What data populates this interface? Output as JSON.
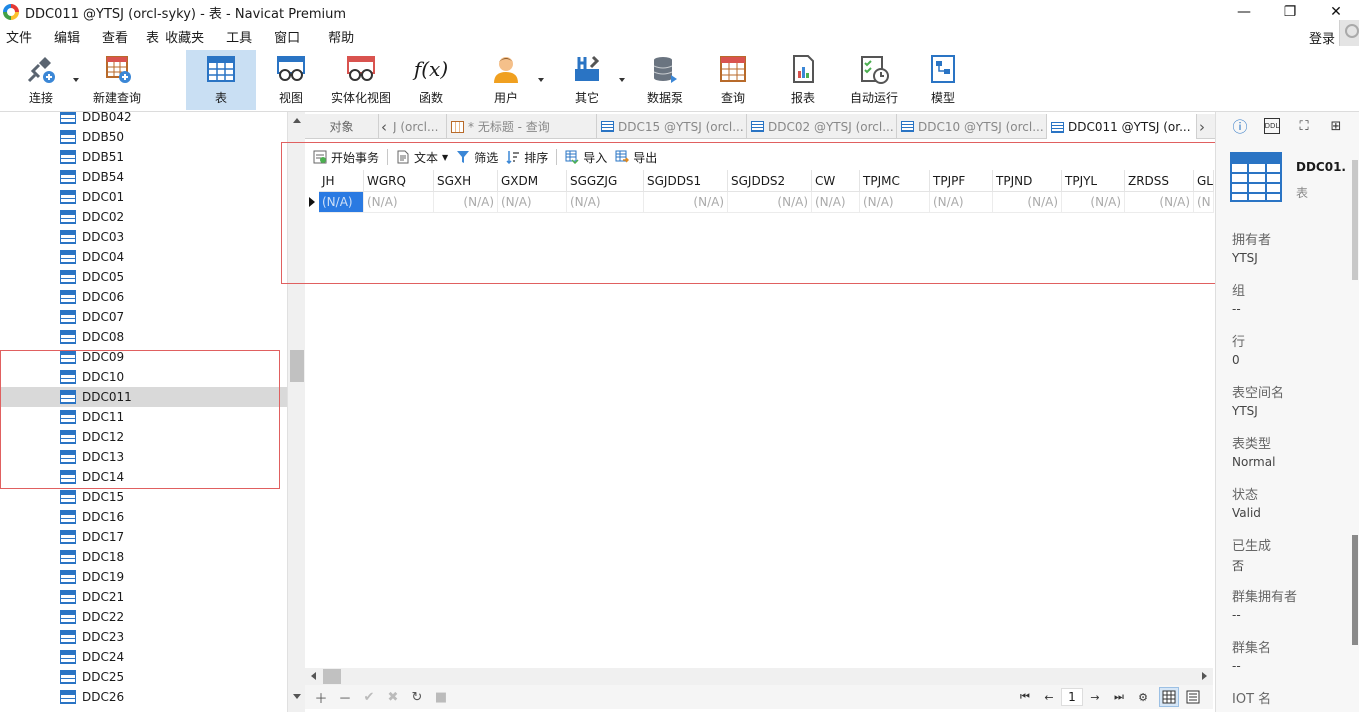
{
  "window": {
    "title": "DDC011 @YTSJ (orcl-syky) - 表 - Navicat Premium",
    "minimize": "—",
    "maximize": "❐",
    "close": "✕"
  },
  "menu": [
    "文件",
    "编辑",
    "查看",
    "表",
    "收藏夹",
    "工具",
    "窗口",
    "帮助"
  ],
  "login_label": "登录",
  "toolbar": [
    {
      "label": "连接",
      "icon": "connect-plug-icon"
    },
    {
      "label": "新建查询",
      "icon": "new-query-icon"
    },
    {
      "label": "表",
      "icon": "table-icon"
    },
    {
      "label": "视图",
      "icon": "view-icon"
    },
    {
      "label": "实体化视图",
      "icon": "materialized-view-icon"
    },
    {
      "label": "函数",
      "icon": "function-icon",
      "glyph": "f(x)"
    },
    {
      "label": "用户",
      "icon": "user-icon"
    },
    {
      "label": "其它",
      "icon": "other-tools-icon"
    },
    {
      "label": "数据泵",
      "icon": "data-pump-icon"
    },
    {
      "label": "查询",
      "icon": "query-icon"
    },
    {
      "label": "报表",
      "icon": "report-icon"
    },
    {
      "label": "自动运行",
      "icon": "automation-icon"
    },
    {
      "label": "模型",
      "icon": "model-icon"
    }
  ],
  "tree": [
    "DDB042",
    "DDB50",
    "DDB51",
    "DDB54",
    "DDC01",
    "DDC02",
    "DDC03",
    "DDC04",
    "DDC05",
    "DDC06",
    "DDC07",
    "DDC08",
    "DDC09",
    "DDC10",
    "DDC011",
    "DDC11",
    "DDC12",
    "DDC13",
    "DDC14",
    "DDC15",
    "DDC16",
    "DDC17",
    "DDC18",
    "DDC19",
    "DDC21",
    "DDC22",
    "DDC23",
    "DDC24",
    "DDC25",
    "DDC26"
  ],
  "selected_tree_item": "DDC011",
  "tabs": {
    "objects": "对象",
    "items": [
      {
        "label": "J (orcl...",
        "kind": "partial"
      },
      {
        "label": "* 无标题 - 查询",
        "kind": "query"
      },
      {
        "label": "DDC15 @YTSJ (orcl...",
        "kind": "table"
      },
      {
        "label": "DDC02 @YTSJ (orcl...",
        "kind": "table"
      },
      {
        "label": "DDC10 @YTSJ (orcl...",
        "kind": "table"
      },
      {
        "label": "DDC011 @YTSJ (or...",
        "kind": "table"
      }
    ]
  },
  "subtoolbar": {
    "begin_transaction": "开始事务",
    "text": "文本",
    "filter": "筛选",
    "sort": "排序",
    "import": "导入",
    "export": "导出"
  },
  "grid": {
    "columns": [
      "JH",
      "WGRQ",
      "SGXH",
      "GXDM",
      "SGGZJG",
      "SGJDDS1",
      "SGJDDS2",
      "CW",
      "TPJMC",
      "TPJPF",
      "TPJND",
      "TPJYL",
      "ZRDSS",
      "GL"
    ],
    "rows": [
      [
        "(N/A)",
        "(N/A)",
        "(N/A)",
        "(N/A)",
        "(N/A)",
        "(N/A)",
        "(N/A)",
        "(N/A)",
        "(N/A)",
        "(N/A)",
        "(N/A)",
        "(N/A)",
        "(N/A)",
        "(N"
      ]
    ]
  },
  "pager": {
    "page": "1"
  },
  "info": {
    "name": "DDC01.",
    "type": "表",
    "props": [
      {
        "key": "拥有者",
        "value": "YTSJ"
      },
      {
        "key": "组",
        "value": "--"
      },
      {
        "key": "行",
        "value": "0"
      },
      {
        "key": "表空间名",
        "value": "YTSJ"
      },
      {
        "key": "表类型",
        "value": "Normal"
      },
      {
        "key": "状态",
        "value": "Valid"
      },
      {
        "key": "已生成",
        "value": "否"
      },
      {
        "key": "群集拥有者",
        "value": "--"
      },
      {
        "key": "群集名",
        "value": "--"
      },
      {
        "key": "IOT 名",
        "value": ""
      }
    ]
  },
  "colors": {
    "accent": "#2a7ae2",
    "table_icon": "#2a74c4",
    "highlight_box": "#e06060",
    "active_toolbar": "#c9dff3"
  }
}
